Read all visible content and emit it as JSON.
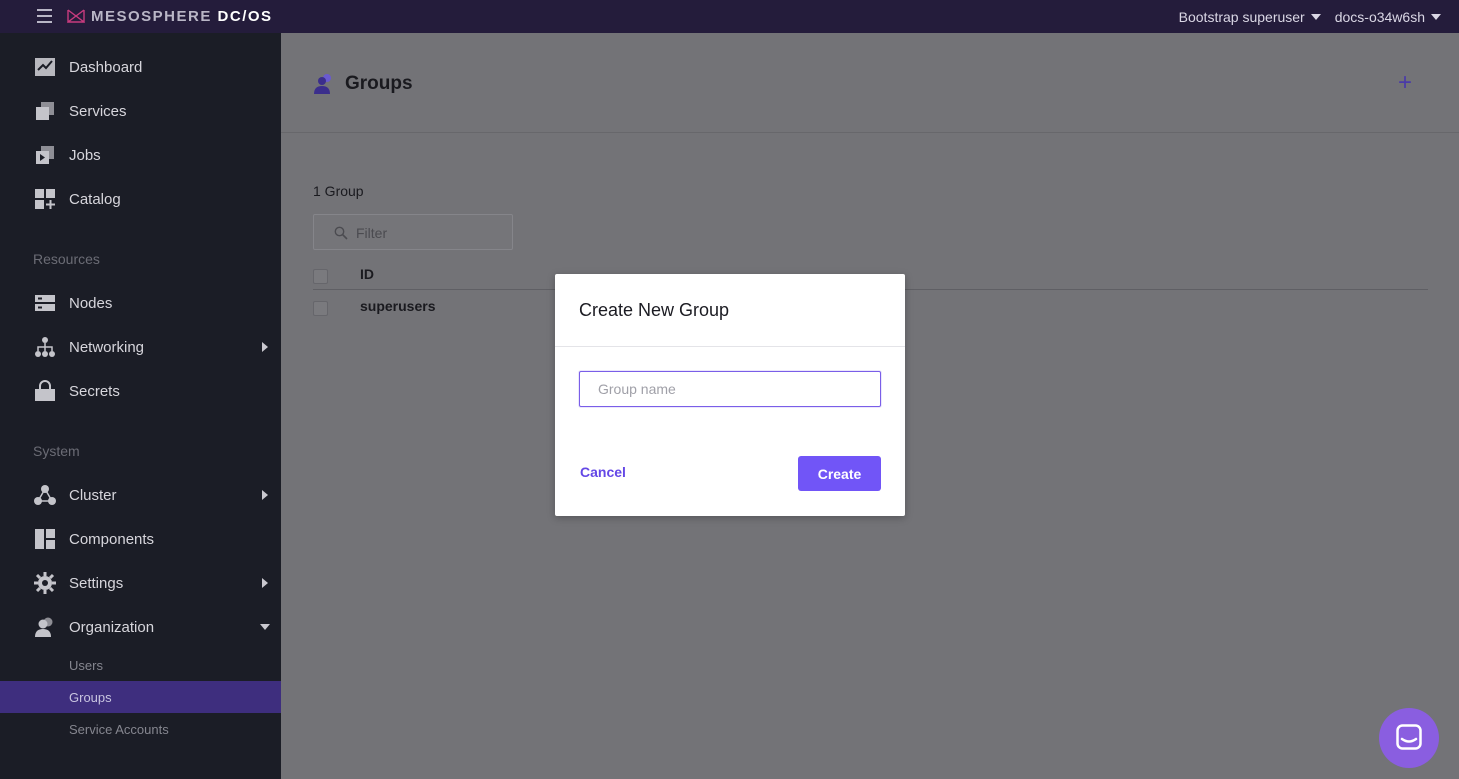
{
  "topbar": {
    "logo_prefix": "MESOSPHERE ",
    "logo_suffix": "DC/OS",
    "user_menu": "Bootstrap superuser",
    "cluster_menu": "docs-o34w6sh"
  },
  "sidebar": {
    "items": [
      {
        "label": "Dashboard",
        "icon": "dashboard-icon"
      },
      {
        "label": "Services",
        "icon": "services-icon"
      },
      {
        "label": "Jobs",
        "icon": "jobs-icon"
      },
      {
        "label": "Catalog",
        "icon": "catalog-icon"
      }
    ],
    "resources_label": "Resources",
    "resources": [
      {
        "label": "Nodes",
        "icon": "nodes-icon"
      },
      {
        "label": "Networking",
        "icon": "networking-icon"
      },
      {
        "label": "Secrets",
        "icon": "secrets-icon"
      }
    ],
    "system_label": "System",
    "system": [
      {
        "label": "Cluster",
        "icon": "cluster-icon"
      },
      {
        "label": "Components",
        "icon": "components-icon"
      },
      {
        "label": "Settings",
        "icon": "gear-icon"
      },
      {
        "label": "Organization",
        "icon": "organization-icon"
      }
    ],
    "organization_sub": [
      {
        "label": "Users"
      },
      {
        "label": "Groups",
        "active": true
      },
      {
        "label": "Service Accounts"
      }
    ]
  },
  "main": {
    "title": "Groups",
    "add_label": "+",
    "count": "1 Group",
    "filter_placeholder": "Filter",
    "table": {
      "header": "ID",
      "rows": [
        "superusers"
      ]
    }
  },
  "modal": {
    "title": "Create New Group",
    "input_placeholder": "Group name",
    "cancel": "Cancel",
    "create": "Create"
  },
  "colors": {
    "accent": "#7155f7",
    "topbar": "#241c3b",
    "sidebar": "#1b1d26",
    "active_item": "#3e2e7e"
  }
}
